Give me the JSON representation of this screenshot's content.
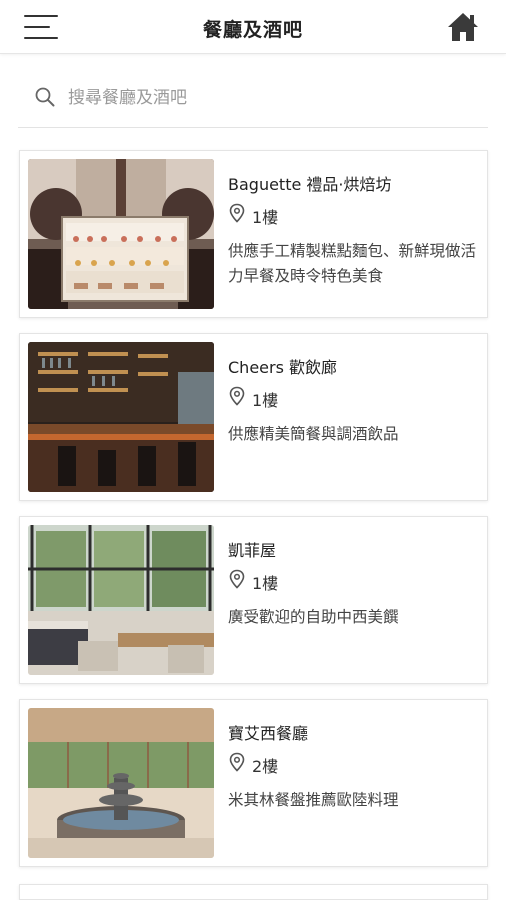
{
  "header": {
    "title": "餐廳及酒吧",
    "menu_icon": "hamburger-menu-icon",
    "home_icon": "home-icon"
  },
  "search": {
    "placeholder": "搜尋餐廳及酒吧",
    "value": "",
    "icon": "search-icon"
  },
  "restaurants": [
    {
      "name": "Baguette 禮品·烘焙坊",
      "floor": "1樓",
      "description": "供應手工精製糕點麵包、新鮮現做活力早餐及時令特色美食"
    },
    {
      "name": "Cheers 歡飲廊",
      "floor": "1樓",
      "description": "供應精美簡餐與調酒飲品"
    },
    {
      "name": "凱菲屋",
      "floor": "1樓",
      "description": "廣受歡迎的自助中西美饌"
    },
    {
      "name": "寶艾西餐廳",
      "floor": "2樓",
      "description": "米其林餐盤推薦歐陸料理"
    }
  ],
  "colors": {
    "text": "#222222",
    "muted": "#9a9a9a",
    "divider": "#e4e4e4"
  }
}
